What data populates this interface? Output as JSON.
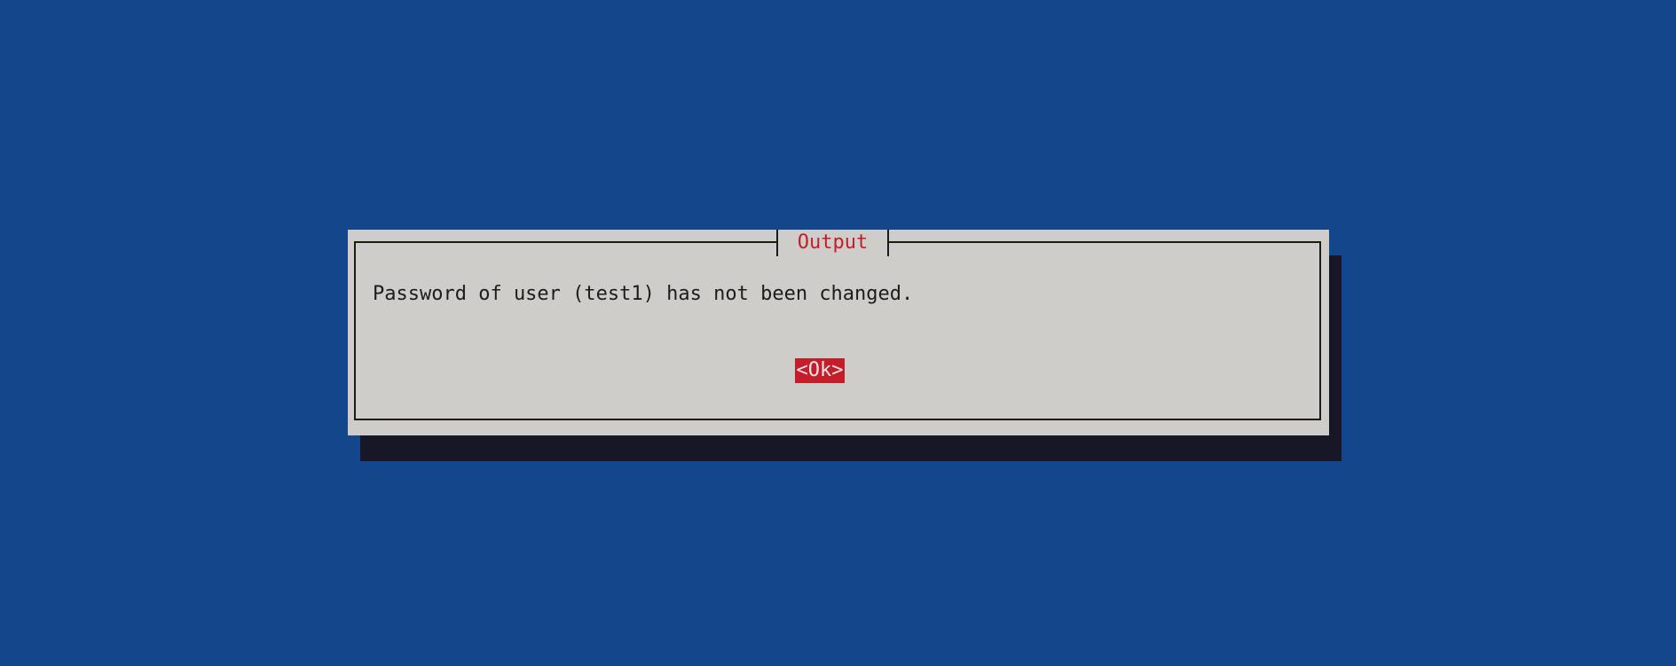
{
  "dialog": {
    "title": "Output",
    "message": "Password of user (test1) has not been changed.",
    "ok_label": "<Ok>"
  },
  "colors": {
    "background": "#13468b",
    "dialog_bg": "#cecdc9",
    "shadow": "#171728",
    "accent": "#c41e2b",
    "text": "#1c1c1c"
  }
}
